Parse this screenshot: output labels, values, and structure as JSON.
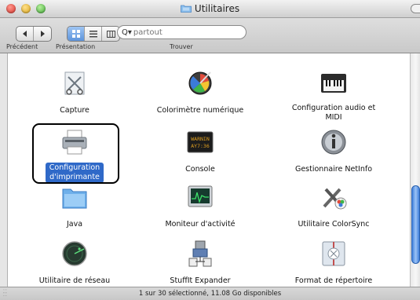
{
  "window": {
    "title": "Utilitaires"
  },
  "toolbar": {
    "back_icon": "back-arrow-icon",
    "forward_icon": "forward-arrow-icon",
    "views": [
      "icon-view",
      "list-view",
      "column-view"
    ],
    "active_view": "icon-view",
    "search_placeholder": "partout",
    "labels": {
      "previous": "Précédent",
      "presentation": "Présentation",
      "find": "Trouver"
    }
  },
  "items": [
    {
      "label": "Capture",
      "icon": "capture-icon",
      "selected": false
    },
    {
      "label": "Colorimètre numérique",
      "icon": "colorimeter-icon",
      "selected": false
    },
    {
      "label_line1": "Configuration audio et",
      "label_line2": "MIDI",
      "icon": "audio-midi-icon",
      "selected": false
    },
    {
      "label_line1": "Configuration",
      "label_line2": "d'imprimante",
      "icon": "printer-icon",
      "selected": true
    },
    {
      "label": "Console",
      "icon": "console-icon",
      "selected": false
    },
    {
      "label": "Gestionnaire NetInfo",
      "icon": "netinfo-icon",
      "selected": false
    },
    {
      "label": "Java",
      "icon": "java-folder-icon",
      "selected": false
    },
    {
      "label": "Moniteur d'activité",
      "icon": "activity-monitor-icon",
      "selected": false
    },
    {
      "label": "Utilitaire ColorSync",
      "icon": "colorsync-icon",
      "selected": false
    },
    {
      "label": "Utilitaire de réseau",
      "icon": "network-utility-icon",
      "selected": false
    },
    {
      "label": "StuffIt Expander",
      "icon": "stuffit-icon",
      "selected": false
    },
    {
      "label": "Format de répertoire",
      "icon": "directory-format-icon",
      "selected": false
    }
  ],
  "console_icon_text": {
    "line1": "WARNIN",
    "line2": "AY7:36"
  },
  "status": {
    "text": "1 sur 30 sélectionné, 11.08 Go disponibles"
  },
  "colors": {
    "selection": "#2f69c8",
    "accent_blue": "#3f7fdc"
  }
}
